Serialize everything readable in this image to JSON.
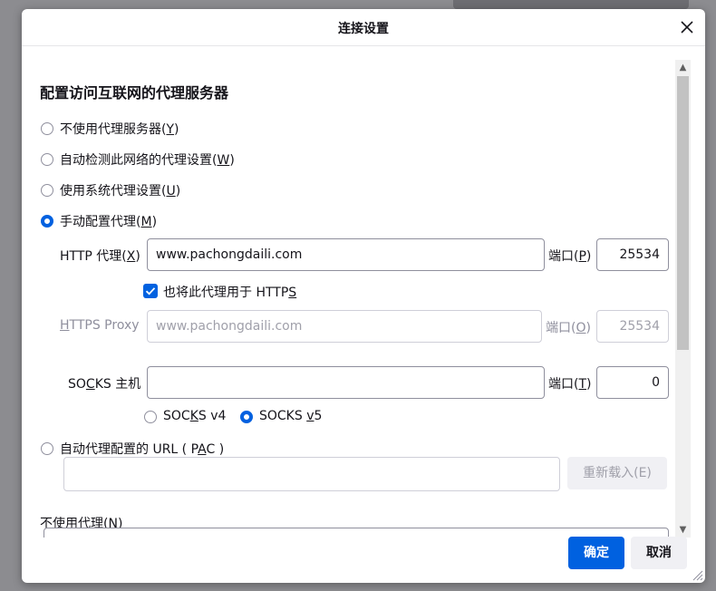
{
  "dialog": {
    "title": "连接设置",
    "heading": "配置访问互联网的代理服务器"
  },
  "proxy_options": {
    "no_proxy": {
      "text": "不使用代理服务器(",
      "key": "Y",
      "end": ")"
    },
    "auto_detect": {
      "text": "自动检测此网络的代理设置(",
      "key": "W",
      "end": ")"
    },
    "system": {
      "text": "使用系统代理设置(",
      "key": "U",
      "end": ")"
    },
    "manual": {
      "text": "手动配置代理(",
      "key": "M",
      "end": ")",
      "checked": true
    }
  },
  "http": {
    "label_pre": "HTTP 代理(",
    "label_key": "X",
    "label_end": ")",
    "value": "www.pachongdaili.com",
    "port_pre": "端口(",
    "port_key": "P",
    "port_end": ")",
    "port": "25534"
  },
  "also_https": {
    "pre": "也将此代理用于 HTTP",
    "key": "S",
    "checked": true
  },
  "https": {
    "label_key": "H",
    "label_rest": "TTPS Proxy",
    "value": "www.pachongdaili.com",
    "port_pre": "端口(",
    "port_key": "O",
    "port_end": ")",
    "port": "25534"
  },
  "socks": {
    "label_pre": "SO",
    "label_key": "C",
    "label_rest": "KS 主机",
    "value": "",
    "port_pre": "端口(",
    "port_key": "T",
    "port_end": ")",
    "port": "0",
    "v4": {
      "pre": "SOC",
      "key": "K",
      "rest": "S v4"
    },
    "v5": {
      "pre": "SOCKS ",
      "key": "v",
      "rest": "5",
      "checked": true
    }
  },
  "pac": {
    "text": "自动代理配置的 URL ( P",
    "key": "A",
    "end": "C )",
    "value": "",
    "reload_label": "重新载入(E)"
  },
  "no_proxy_for": {
    "text": "不使用代理(",
    "key": "N",
    "end": ")"
  },
  "footer": {
    "ok": "确定",
    "cancel": "取消"
  },
  "colors": {
    "accent": "#0061e0",
    "border": "#8f8f9d",
    "disabled_text": "#8f8f9d"
  }
}
